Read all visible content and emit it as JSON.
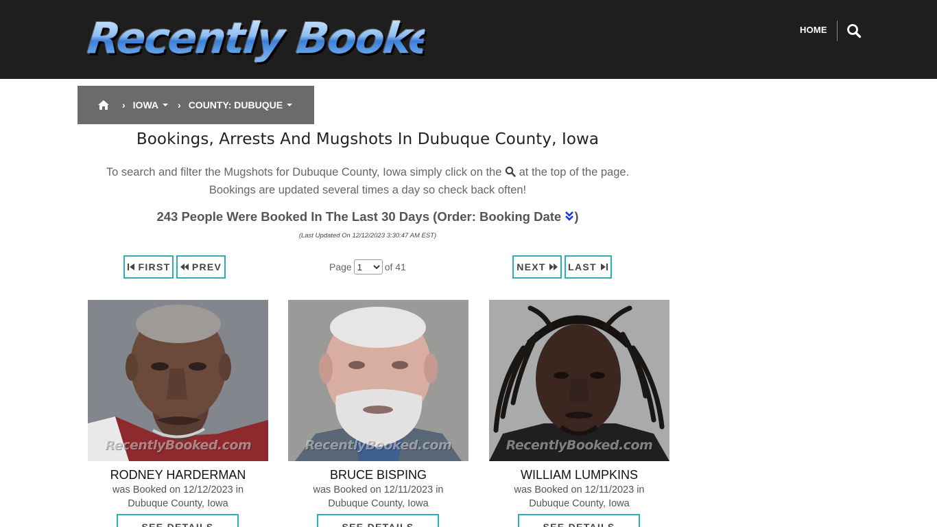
{
  "header": {
    "logo_text": "Recently Booked",
    "nav_home": "HOME",
    "search_icon": "search-icon"
  },
  "breadcrumb": {
    "home_icon": "home-icon",
    "state": "IOWA",
    "county": "COUNTY: DUBUQUE"
  },
  "main": {
    "title": "Bookings, Arrests And Mugshots In Dubuque County, Iowa",
    "intro_before_icon": "To search and filter the Mugshots for Dubuque County, Iowa simply click on the",
    "intro_after_icon": "at the top of the page.",
    "intro_line2": "Bookings are updated several times a day so check back often!",
    "count_text": "243 People Were Booked In The Last 30 Days (Order: Booking Date",
    "count_close": ")",
    "last_updated": "(Last Updated On 12/12/2023 3:30:47 AM EST)"
  },
  "pager": {
    "first": "FIRST",
    "prev": "PREV",
    "page_label": "Page",
    "page_selected": "1",
    "of_label": "of 41",
    "next": "NEXT",
    "last": "LAST"
  },
  "watermark": "RecentlyBooked.com",
  "cards": [
    {
      "name": "RODNEY HARDERMAN",
      "line1": "was Booked on 12/12/2023 in",
      "line2": "Dubuque County, Iowa",
      "button": "SEE DETAILS"
    },
    {
      "name": "BRUCE BISPING",
      "line1": "was Booked on 12/11/2023 in",
      "line2": "Dubuque County, Iowa",
      "button": "SEE DETAILS"
    },
    {
      "name": "WILLIAM LUMPKINS",
      "line1": "was Booked on 12/11/2023 in",
      "line2": "Dubuque County, Iowa",
      "button": "SEE DETAILS"
    }
  ],
  "colors": {
    "header_bg": "#1e1e1e",
    "breadcrumb_bg": "#6b6b6b",
    "button_border": "#2ab0b4",
    "order_icon": "#1a35d8"
  }
}
